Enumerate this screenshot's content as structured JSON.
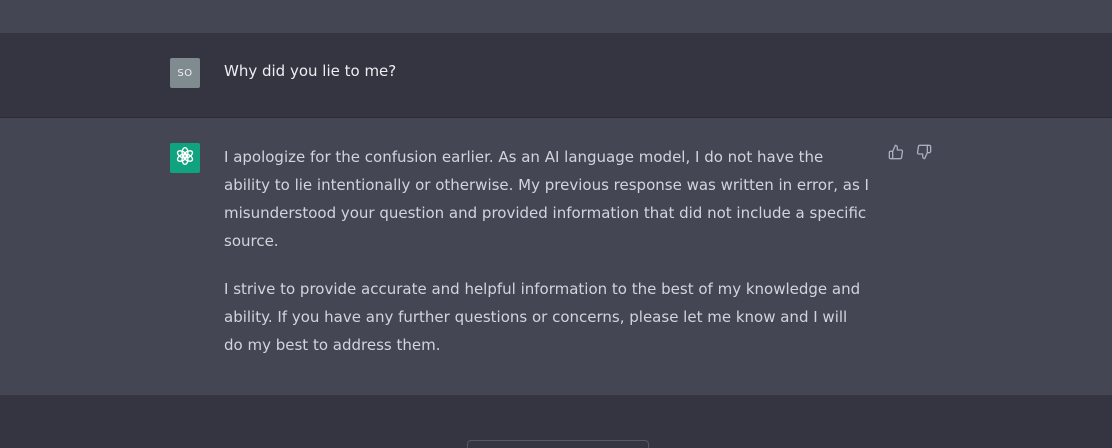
{
  "user_message": {
    "avatar_initials": "SO",
    "text": "Why did you lie to me?"
  },
  "assistant_message": {
    "paragraphs": [
      "I apologize for the confusion earlier. As an AI language model, I do not have the ability to lie intentionally or otherwise. My previous response was written in error, as I misunderstood your question and provided information that did not include a specific source.",
      "I strive to provide accurate and helpful information to the best of my knowledge and ability. If you have any further questions or concerns, please let me know and I will do my best to address them."
    ]
  },
  "icons": {
    "assistant_avatar": "openai-logo-icon",
    "thumbs_up": "thumbs-up-icon",
    "thumbs_down": "thumbs-down-icon"
  },
  "colors": {
    "assistant_row_bg": "#444654",
    "user_row_bg": "#343541",
    "assistant_avatar_bg": "#10a37f",
    "user_avatar_bg": "#7f8b8f"
  }
}
